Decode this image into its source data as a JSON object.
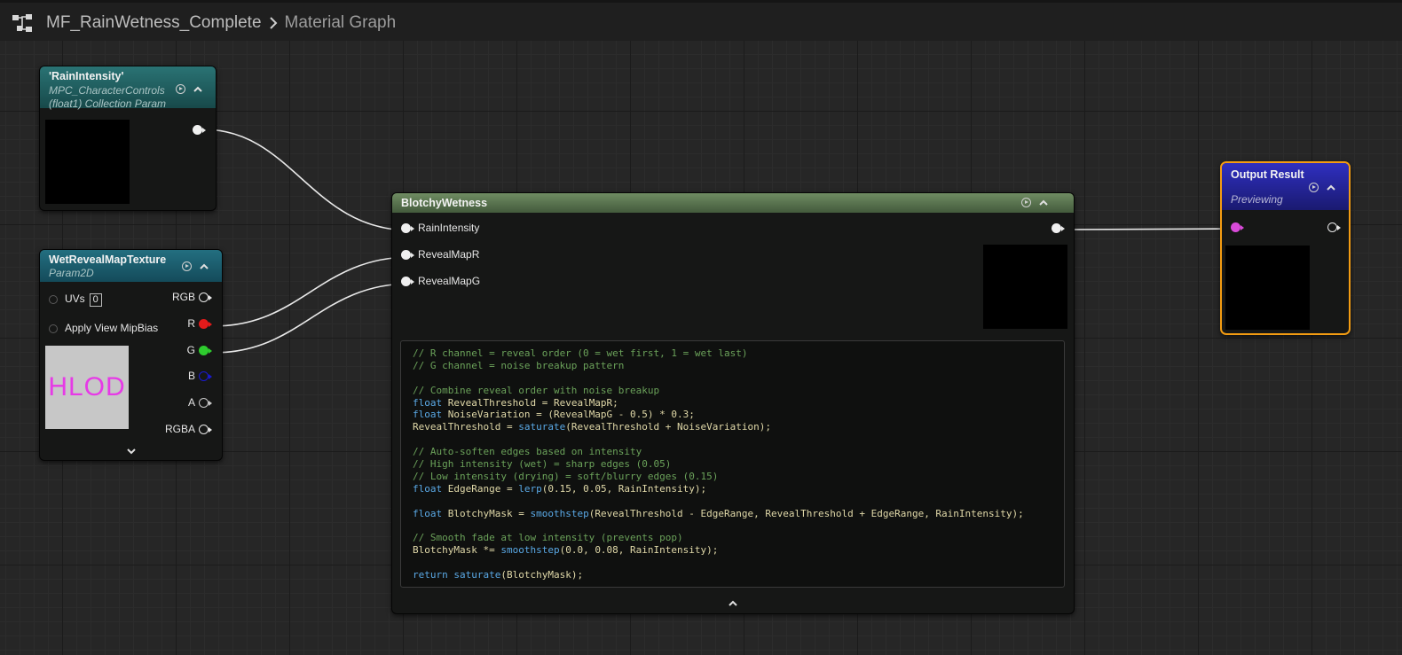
{
  "breadcrumb": {
    "asset": "MF_RainWetness_Complete",
    "graph": "Material Graph"
  },
  "nodes": {
    "rain_intensity": {
      "title": "'RainIntensity'",
      "subtitle1": "MPC_CharacterControls",
      "subtitle2": "(float1) Collection Param"
    },
    "wet_reveal": {
      "title": "WetRevealMapTexture",
      "subtitle": "Param2D",
      "uvs_label": "UVs",
      "uvs_value": "0",
      "mip_label": "Apply View MipBias",
      "preview_text": "HLOD",
      "outputs": [
        "RGB",
        "R",
        "G",
        "B",
        "A",
        "RGBA"
      ]
    },
    "blotchy": {
      "title": "BlotchyWetness",
      "inputs": [
        "RainIntensity",
        "RevealMapR",
        "RevealMapG"
      ],
      "code_lines": [
        [
          [
            "cm",
            "// R channel = reveal order (0 = wet first, 1 = wet last)"
          ]
        ],
        [
          [
            "cm",
            "// G channel = noise breakup pattern"
          ]
        ],
        [],
        [
          [
            "cm",
            "// Combine reveal order with noise breakup"
          ]
        ],
        [
          [
            "kw",
            "float"
          ],
          [
            "pl",
            " RevealThreshold = RevealMapR;"
          ]
        ],
        [
          [
            "kw",
            "float"
          ],
          [
            "pl",
            " NoiseVariation = (RevealMapG - 0.5) * 0.3;"
          ]
        ],
        [
          [
            "pl",
            "RevealThreshold = "
          ],
          [
            "kw",
            "saturate"
          ],
          [
            "pl",
            "(RevealThreshold + NoiseVariation);"
          ]
        ],
        [],
        [
          [
            "cm",
            "// Auto-soften edges based on intensity"
          ]
        ],
        [
          [
            "cm",
            "// High intensity (wet) = sharp edges (0.05)"
          ]
        ],
        [
          [
            "cm",
            "// Low intensity (drying) = soft/blurry edges (0.15)"
          ]
        ],
        [
          [
            "kw",
            "float"
          ],
          [
            "pl",
            " EdgeRange = "
          ],
          [
            "kw",
            "lerp"
          ],
          [
            "pl",
            "(0.15, 0.05, RainIntensity);"
          ]
        ],
        [],
        [
          [
            "kw",
            "float"
          ],
          [
            "pl",
            " BlotchyMask = "
          ],
          [
            "kw",
            "smoothstep"
          ],
          [
            "pl",
            "(RevealThreshold - EdgeRange, RevealThreshold + EdgeRange, RainIntensity);"
          ]
        ],
        [],
        [
          [
            "cm",
            "// Smooth fade at low intensity (prevents pop)"
          ]
        ],
        [
          [
            "pl",
            "BlotchyMask *= "
          ],
          [
            "kw",
            "smoothstep"
          ],
          [
            "pl",
            "(0.0, 0.08, RainIntensity);"
          ]
        ],
        [],
        [
          [
            "kw",
            "return"
          ],
          [
            "pl",
            " "
          ],
          [
            "kw",
            "saturate"
          ],
          [
            "pl",
            "(BlotchyMask);"
          ]
        ]
      ]
    },
    "output": {
      "title": "Output Result",
      "subtitle": "Previewing"
    }
  },
  "colors": {
    "param_header": "#1e5e5f",
    "texture_header": "#1a5a6a",
    "custom_header": "#5a7a4e",
    "output_header": "#2a2aa8",
    "output_border": "#f39c12",
    "pin_r": "#e31b1b",
    "pin_g": "#2ecc2e",
    "pin_b": "#1a1ad0",
    "pin_output": "#d94bd9"
  },
  "icons": [
    "graph-icon",
    "chevron-right-icon",
    "preview-toggle-icon",
    "collapse-icon",
    "expand-icon"
  ]
}
